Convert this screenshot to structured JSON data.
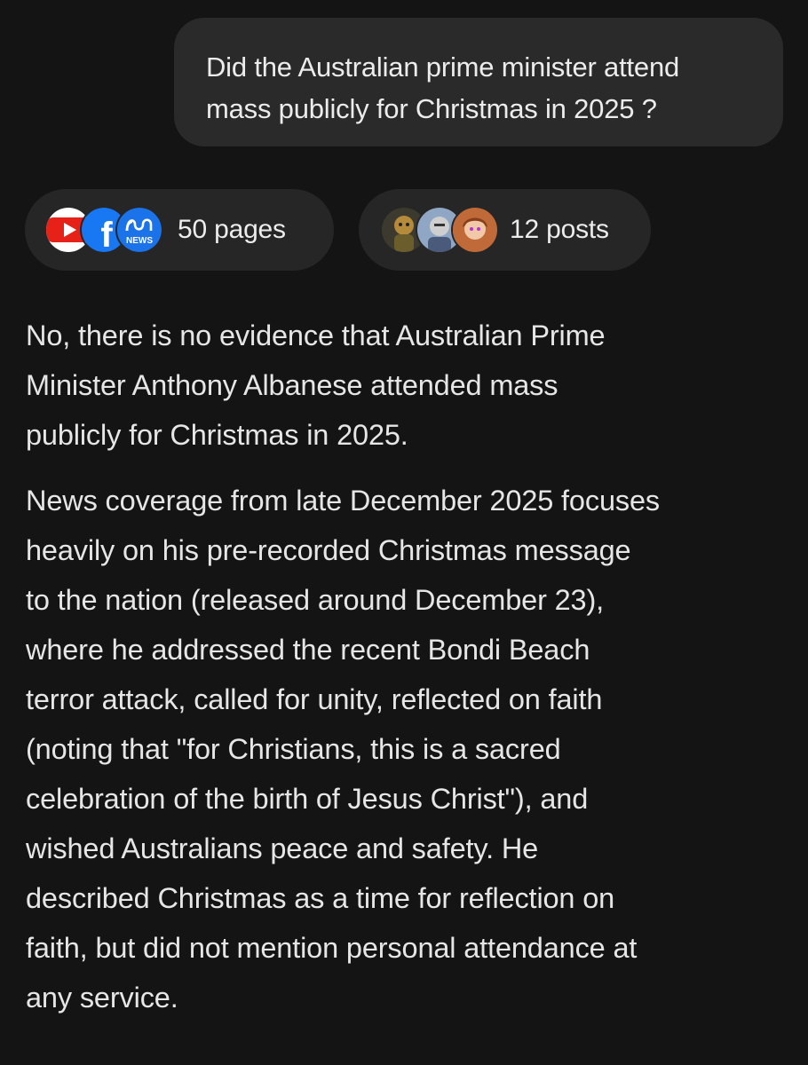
{
  "user_message": {
    "line1": "Did the Australian prime minister attend",
    "line2": "mass publicly for Christmas in 2025 ?"
  },
  "sources": {
    "pages": {
      "label": "50 pages",
      "icons": [
        "youtube-icon",
        "facebook-icon",
        "abc-news-icon"
      ],
      "icon_text": {
        "facebook": "f",
        "abc_news": "NEWS"
      },
      "colors": {
        "youtube": "#e62117",
        "facebook": "#1877f2",
        "abc_news": "#1a73e8"
      }
    },
    "posts": {
      "label": "12 posts",
      "icons": [
        "avatar-1",
        "avatar-2",
        "avatar-3"
      ]
    }
  },
  "answer": {
    "paragraph1": [
      "No, there is no evidence that Australian Prime",
      "Minister Anthony Albanese attended mass",
      "publicly for Christmas in 2025."
    ],
    "paragraph2": [
      "News coverage from late December 2025 focuses",
      "heavily on his pre-recorded Christmas message",
      "to the nation (released around December 23),",
      "where he addressed the recent Bondi Beach",
      "terror attack, called for unity, reflected on faith",
      "(noting that \"for Christians, this is a sacred",
      "celebration of the birth of Jesus Christ\"), and",
      "wished Australians peace and safety. He",
      "described Christmas as a time for reflection on",
      "faith, but did not mention personal attendance at",
      "any service."
    ]
  }
}
